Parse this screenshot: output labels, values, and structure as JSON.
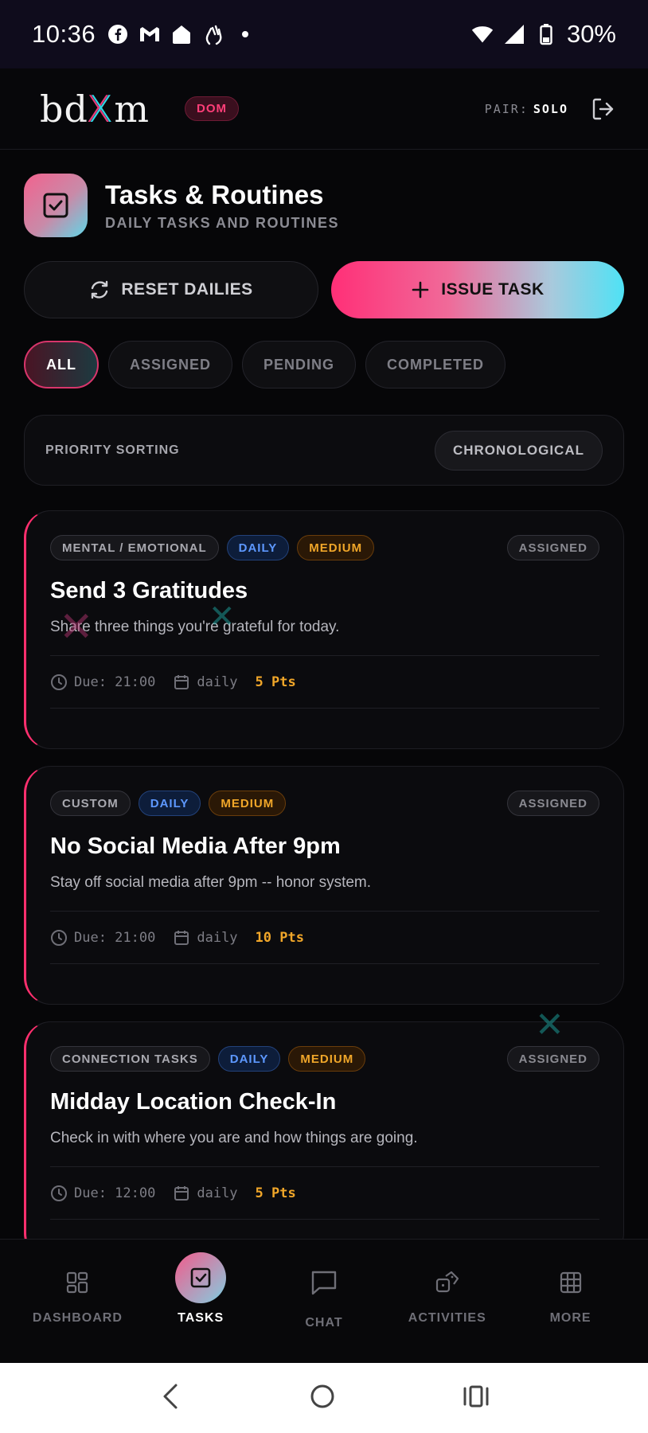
{
  "status_bar": {
    "time": "10:36",
    "battery": "30%",
    "icons": [
      "facebook-icon",
      "gmail-icon",
      "home-icon",
      "gesture-icon",
      "dot-icon",
      "wifi-icon",
      "signal-icon",
      "battery-icon"
    ]
  },
  "header": {
    "logo": "bdXm",
    "role_badge": "DOM",
    "pair_label": "PAIR:",
    "pair_value": "SOLO"
  },
  "page": {
    "title": "Tasks & Routines",
    "subtitle": "DAILY TASKS AND ROUTINES"
  },
  "actions": {
    "reset_label": "RESET DAILIES",
    "issue_label": "ISSUE TASK"
  },
  "filters": [
    {
      "label": "ALL",
      "active": true
    },
    {
      "label": "ASSIGNED",
      "active": false
    },
    {
      "label": "PENDING",
      "active": false
    },
    {
      "label": "COMPLETED",
      "active": false
    }
  ],
  "sorting": {
    "label": "PRIORITY SORTING",
    "value": "CHRONOLOGICAL"
  },
  "tasks": [
    {
      "category": "MENTAL / EMOTIONAL",
      "frequency": "DAILY",
      "priority": "MEDIUM",
      "status": "ASSIGNED",
      "title": "Send 3 Gratitudes",
      "description": "Share three things you're grateful for today.",
      "due": "Due: 21:00",
      "repeat": "daily",
      "points": "5 Pts"
    },
    {
      "category": "CUSTOM",
      "frequency": "DAILY",
      "priority": "MEDIUM",
      "status": "ASSIGNED",
      "title": "No Social Media After 9pm",
      "description": "Stay off social media after 9pm -- honor system.",
      "due": "Due: 21:00",
      "repeat": "daily",
      "points": "10 Pts"
    },
    {
      "category": "CONNECTION TASKS",
      "frequency": "DAILY",
      "priority": "MEDIUM",
      "status": "ASSIGNED",
      "title": "Midday Location Check-In",
      "description": "Check in with where you are and how things are going.",
      "due": "Due: 12:00",
      "repeat": "daily",
      "points": "5 Pts"
    }
  ],
  "bottom_nav": [
    {
      "label": "DASHBOARD",
      "icon": "grid-layout-icon",
      "active": false
    },
    {
      "label": "TASKS",
      "icon": "checkbox-icon",
      "active": true
    },
    {
      "label": "CHAT",
      "icon": "chat-bubble-icon",
      "active": false
    },
    {
      "label": "ACTIVITIES",
      "icon": "dice-icon",
      "active": false
    },
    {
      "label": "MORE",
      "icon": "grid-icon",
      "active": false
    }
  ],
  "colors": {
    "accent_pink": "#ff2f6e",
    "accent_cyan": "#4fe2f5",
    "priority_orange": "#f0a629",
    "frequency_blue": "#5d98ff"
  }
}
